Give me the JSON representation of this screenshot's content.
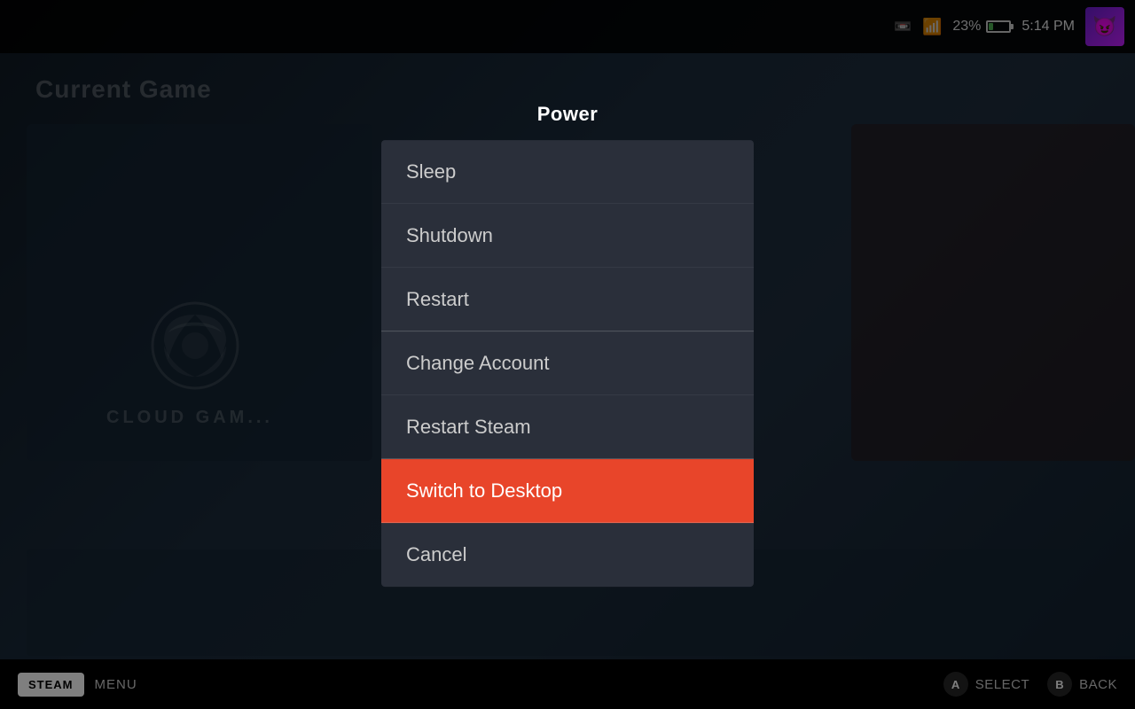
{
  "background": {
    "current_game_label": "Current Game"
  },
  "top_bar": {
    "battery_percent": "23%",
    "time": "5:14 PM",
    "avatar_emoji": "😈"
  },
  "modal": {
    "title": "Power",
    "items": [
      {
        "id": "sleep",
        "label": "Sleep",
        "selected": false,
        "divider_after": false
      },
      {
        "id": "shutdown",
        "label": "Shutdown",
        "selected": false,
        "divider_after": false
      },
      {
        "id": "restart",
        "label": "Restart",
        "selected": false,
        "divider_after": true
      },
      {
        "id": "change-account",
        "label": "Change Account",
        "selected": false,
        "divider_after": false
      },
      {
        "id": "restart-steam",
        "label": "Restart Steam",
        "selected": false,
        "divider_after": true
      },
      {
        "id": "switch-to-desktop",
        "label": "Switch to Desktop",
        "selected": true,
        "divider_after": true
      },
      {
        "id": "cancel",
        "label": "Cancel",
        "selected": false,
        "divider_after": false
      }
    ]
  },
  "bottom_bar": {
    "steam_label": "STEAM",
    "menu_label": "MENU",
    "select_label": "SELECT",
    "back_label": "BACK",
    "select_btn": "A",
    "back_btn": "B"
  }
}
